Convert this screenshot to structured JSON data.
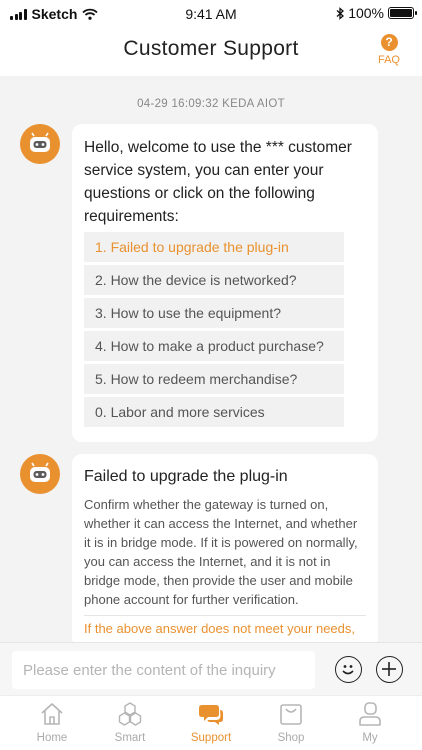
{
  "status_bar": {
    "carrier": "Sketch",
    "time": "9:41 AM",
    "battery": "100%"
  },
  "header": {
    "title": "Customer Support",
    "faq_label": "FAQ",
    "faq_icon": "?"
  },
  "chat": {
    "timestamp": "04-29 16:09:32  KEDA AIOT",
    "welcome": {
      "text": "Hello, welcome to use the *** customer service system, you can enter your questions or click on the following requirements:",
      "options": [
        "1. Failed to upgrade the plug-in",
        "2. How the device is networked?",
        "3. How to use the equipment?",
        "4. How to make a product purchase?",
        "5. How to redeem merchandise?",
        "0. Labor and more services"
      ]
    },
    "answer": {
      "title": "Failed to upgrade the plug-in",
      "body": "Confirm whether the gateway is turned on, whether it can access the Internet, and whether it is in bridge mode. If it is powered on normally, you can access the Internet, and it is not in bridge mode, then provide the user and mobile phone account for further verification.",
      "more": "If the above answer does not meet your needs,"
    }
  },
  "input": {
    "placeholder": "Please enter the content of the inquiry"
  },
  "tabs": [
    {
      "label": "Home",
      "icon": "home-icon"
    },
    {
      "label": "Smart",
      "icon": "smart-icon"
    },
    {
      "label": "Support",
      "icon": "support-icon"
    },
    {
      "label": "Shop",
      "icon": "shop-icon"
    },
    {
      "label": "My",
      "icon": "profile-icon"
    }
  ],
  "colors": {
    "accent": "#e9912f",
    "background": "#f3f3f3",
    "option_bg": "#f1f1f1"
  }
}
